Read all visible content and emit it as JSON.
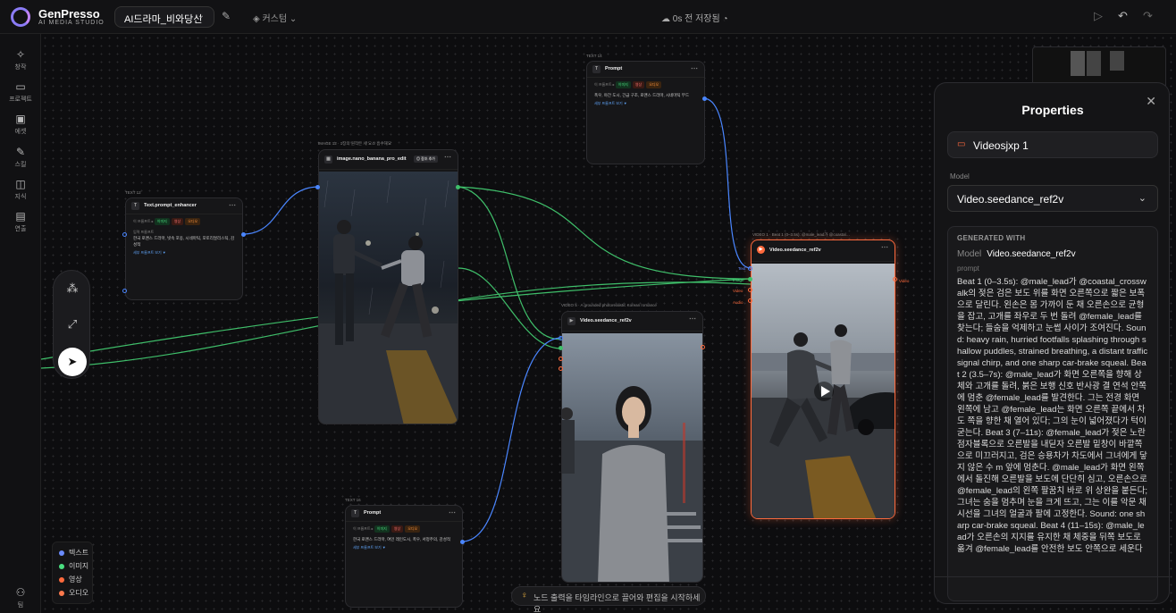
{
  "app": {
    "name": "GenPresso",
    "subtitle": "AI MEDIA STUDIO",
    "project": "AI드라마_비와당신",
    "custom": "커스텀",
    "saved": "0s 전 저장됨"
  },
  "sidebar": [
    {
      "icon": "create-icon",
      "label": "창작"
    },
    {
      "icon": "folder-icon",
      "label": "프로젝트"
    },
    {
      "icon": "asset-icon",
      "label": "에셋"
    },
    {
      "icon": "style-icon",
      "label": "스킬"
    },
    {
      "icon": "book-icon",
      "label": "지식"
    },
    {
      "icon": "direct-icon",
      "label": "연출"
    },
    {
      "icon": "team-icon",
      "label": "팀"
    }
  ],
  "nodes": {
    "text12": {
      "tag": "TEXT 12",
      "title": "Text.prompt_enhancer",
      "row_label": "이 프롬프트 ▸",
      "chips": [
        "이미지",
        "영상",
        "오디오"
      ],
      "sub": "입력 프롬프트",
      "body": "한국 로맨스 드라마, 빗속 포옹, 시네마틱, 포토리얼리스틱, 감성적",
      "link": "세부 프롬프트 보기 ▼"
    },
    "image12": {
      "tag": "IMAGE 12",
      "tag_note": "· 1장의 원작은 세 요소 흡수해요",
      "title": "image.nano_banana_pro_edit",
      "badge": "◎ 참조 추가"
    },
    "text14": {
      "tag": "TEXT 14",
      "title": "Prompt",
      "row_label": "이 프롬프트 ▸",
      "chips": [
        "이미지",
        "영상",
        "오디오"
      ],
      "body": "폭우, 야간 도시, 긴급 구조, 로맨스 드라마, 시네마틱 무드",
      "link": "세부 프롬프트 보기 ▼"
    },
    "text16": {
      "tag": "TEXT 16",
      "title": "Prompt",
      "row_label": "이 프롬프트 ▸",
      "chips": [
        "이미지",
        "영상",
        "오디오"
      ],
      "body": "한국 로맨스 드라마, 여인 레인도시, 폭우, 서정주의, 감성적",
      "link": "세부 프롬프트 보기 ▼"
    },
    "video5": {
      "tag": "VIDEO 5",
      "tag_note": "· A grounded photorealistic Korean romance",
      "title": "Video.seedance_ref2v"
    },
    "video1": {
      "tag": "VIDEO 1",
      "tag_note": "· Beat 1 (0–3.5s): @male_lead가 @coastal…",
      "title": "Video.seedance_ref2v",
      "inputs": [
        "Text",
        "Image",
        "Video",
        "Audio"
      ],
      "output": "Video"
    }
  },
  "legend": [
    {
      "label": "텍스트",
      "color": "#6b8cff"
    },
    {
      "label": "이미지",
      "color": "#4ade80"
    },
    {
      "label": "영상",
      "color": "#ff6a3d"
    },
    {
      "label": "오디오",
      "color": "#ff7a4d"
    }
  ],
  "hint": "노드 출력을 타임라인으로 끌어와 편집을 시작하세요",
  "properties": {
    "title": "Properties",
    "name": "Videosjxp 1",
    "model_label": "Model",
    "model": "Video.seedance_ref2v",
    "generated_with": "GENERATED WITH",
    "gw_model_label": "Model",
    "gw_model": "Video.seedance_ref2v",
    "prompt_label": "prompt",
    "prompt": "Beat 1 (0–3.5s): @male_lead가 @coastal_crosswalk의 젖은 검은 보도 위를 화면 오른쪽으로 짧은 보폭으로 달린다. 왼손은 몸 가까이 둔 채 오른손으로 균형을 잡고, 고개를 좌우로 두 번 돌려 @female_lead를 찾는다; 들숨을 억제하고 눈썹 사이가 조여진다. Sound: heavy rain, hurried footfalls splashing through shallow puddles, strained breathing, a distant traffic signal chirp, and one sharp car-brake squeal. Beat 2 (3.5–7s): @male_lead가 화면 오른쪽을 향해 상체와 고개를 돌려, 붉은 보행 신호 반사광 결 연석 안쪽에 멈춘 @female_lead를 발견한다. 그는 전경 화면 왼쪽에 남고 @female_lead는 화면 오른쪽 끝에서 차도 쪽을 향한 채 열어 있다; 그의 눈이 넓어졌다가 턱이 굳는다. Beat 3 (7–11s): @female_lead가 젖은 노란 점자블록으로 오른발을 내딛자 오른발 밑창이 바깥쪽으로 미끄러지고, 검은 승용차가 차도에서 그녀에게 닿지 않은 수 m 앞에 멈춘다. @male_lead가 화면 왼쪽에서 돌진해 오른발을 보도에 단단히 심고, 오른손으로 @female_lead의 왼쪽 팔꿈치 바로 위 상완을 붙든다; 그녀는 숨을 멈추며 눈을 크게 뜨고, 그는 이를 악문 채 시선을 그녀의 얼굴과 팔에 고정한다. Sound: one sharp car-brake squeal. Beat 4 (11–15s): @male_lead가 오른손의 지지를 유지한 채 체중을 뒤쪽 보도로 옮겨 @female_lead를 안전한 보도 안쪽으로 세운다"
  }
}
